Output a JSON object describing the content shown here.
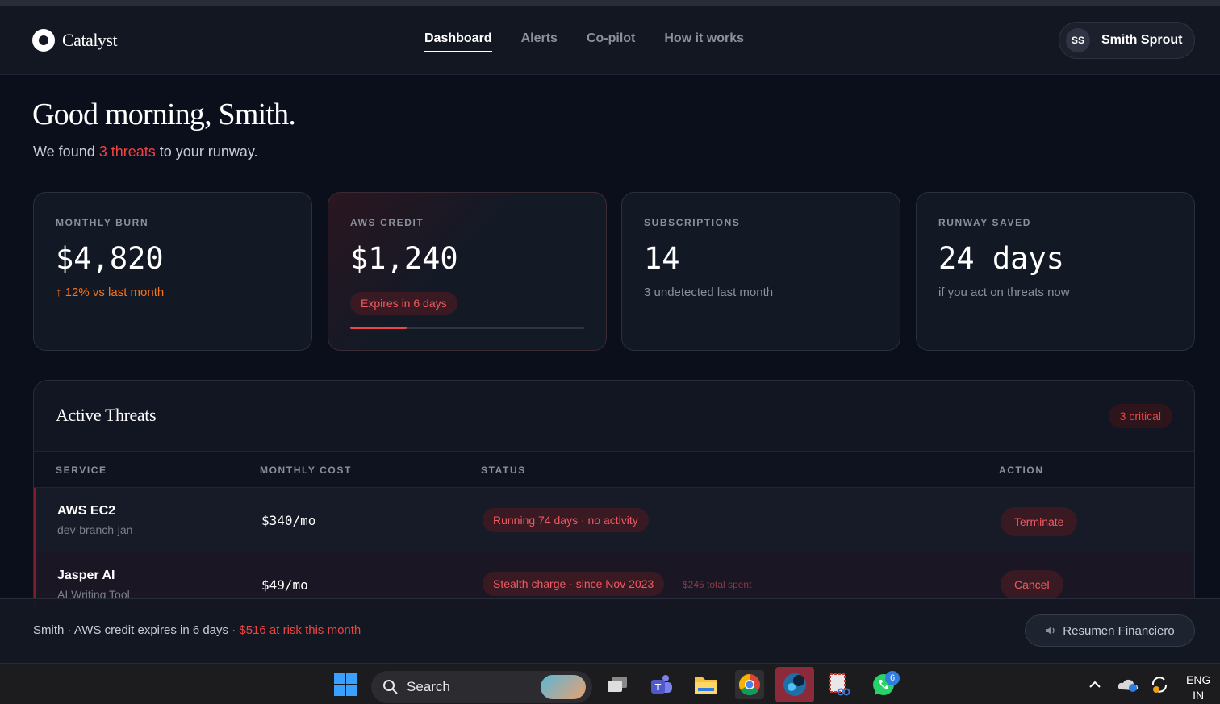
{
  "app": {
    "name": "Catalyst"
  },
  "nav": {
    "links": [
      {
        "label": "Dashboard",
        "active": true
      },
      {
        "label": "Alerts"
      },
      {
        "label": "Co-pilot"
      },
      {
        "label": "How it works"
      }
    ],
    "user": {
      "initials": "SS",
      "name": "Smith Sprout"
    }
  },
  "greeting": {
    "title": "Good morning, Smith.",
    "sub_prefix": "We found ",
    "sub_highlight": "3 threats",
    "sub_suffix": " to your runway."
  },
  "cards": [
    {
      "label": "MONTHLY BURN",
      "value": "$4,820",
      "sub": "↑ 12% vs last month"
    },
    {
      "label": "AWS CREDIT",
      "value": "$1,240",
      "badge": "Expires in 6 days",
      "progress": 0.24
    },
    {
      "label": "SUBSCRIPTIONS",
      "value": "14",
      "sub": "3 undetected last month"
    },
    {
      "label": "RUNWAY SAVED",
      "value": "24 days",
      "sub": "if you act on threats now"
    }
  ],
  "threats": {
    "title": "Active Threats",
    "badge": "3 critical",
    "columns": [
      "SERVICE",
      "MONTHLY COST",
      "STATUS",
      "ACTION"
    ],
    "rows": [
      {
        "service": "AWS EC2",
        "detail": "dev-branch-jan",
        "cost": "$340/mo",
        "status": "Running 74 days · no activity",
        "note": "",
        "action": "Terminate"
      },
      {
        "service": "Jasper AI",
        "detail": "AI Writing Tool",
        "cost": "$49/mo",
        "status": "Stealth charge · since Nov 2023",
        "note": "$245 total spent",
        "action": "Cancel"
      }
    ]
  },
  "bottom_bar": {
    "text": "Smith · AWS credit expires in 6 days · ",
    "risk": "$516 at risk this month",
    "button": "Resumen Financiero"
  },
  "taskbar": {
    "search_label": "Search",
    "lang": "ENG",
    "region": "IN",
    "whatsapp_badge": "6"
  },
  "colors": {
    "accent_red": "#ef4444",
    "orange": "#f97316",
    "bg": "#0b0f1c"
  }
}
